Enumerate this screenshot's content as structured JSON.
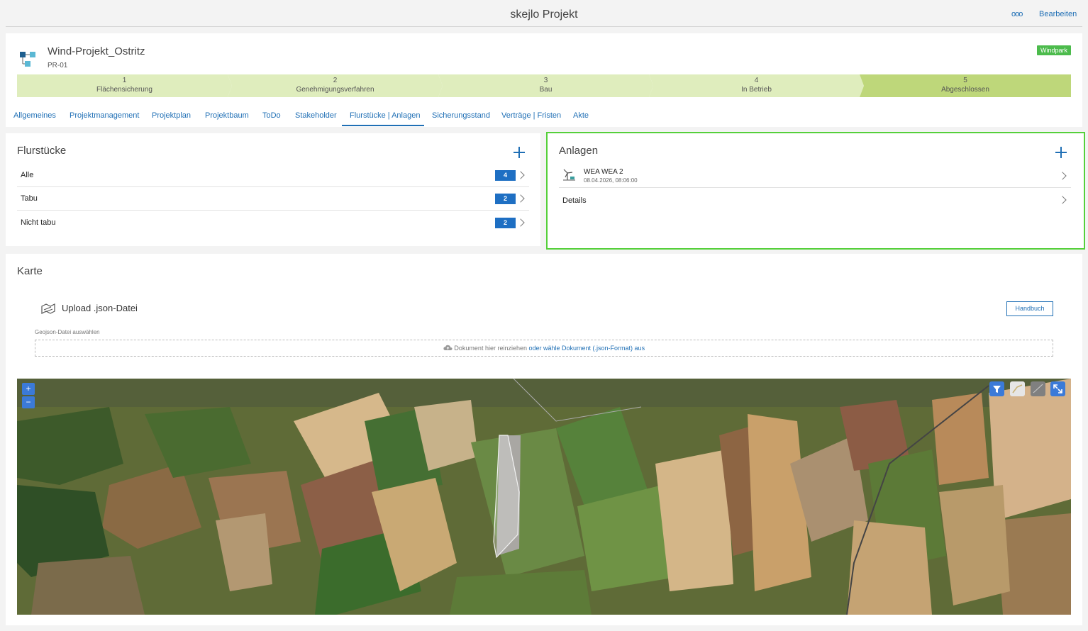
{
  "header": {
    "title": "skejlo Projekt",
    "more_label": "ooo",
    "edit_label": "Bearbeiten"
  },
  "project": {
    "name": "Wind-Projekt_Ostritz",
    "code": "PR-01",
    "type_badge": "Windpark",
    "icon": "project-tree-icon"
  },
  "phases": [
    {
      "num": "1",
      "label": "Flächensicherung"
    },
    {
      "num": "2",
      "label": "Genehmigungsverfahren"
    },
    {
      "num": "3",
      "label": "Bau"
    },
    {
      "num": "4",
      "label": "In Betrieb"
    },
    {
      "num": "5",
      "label": "Abgeschlossen"
    }
  ],
  "tabs": [
    "Allgemeines",
    "Projektmanagement",
    "Projektplan",
    "Projektbaum",
    "ToDo",
    "Stakeholder",
    "Flurstücke | Anlagen",
    "Sicherungsstand",
    "Verträge | Fristen",
    "Akte"
  ],
  "active_tab": "Flurstücke | Anlagen",
  "flurstuecke": {
    "title": "Flurstücke",
    "rows": [
      {
        "label": "Alle",
        "count": "4"
      },
      {
        "label": "Tabu",
        "count": "2"
      },
      {
        "label": "Nicht tabu",
        "count": "2"
      }
    ]
  },
  "anlagen": {
    "title": "Anlagen",
    "item": {
      "name": "WEA WEA 2",
      "timestamp": "08.04.2026, 08:06:00",
      "icon": "wind-turbine-icon"
    },
    "details_label": "Details"
  },
  "karte": {
    "title": "Karte",
    "upload_title": "Upload .json-Datei",
    "upload_icon": "map-upload-icon",
    "handbuch_label": "Handbuch",
    "drop_label": "Geojson-Datei auswählen",
    "drop_text": "Dokument hier reinziehen",
    "drop_link": "oder wähle Dokument (.json-Format) aus",
    "zoom_in": "+",
    "zoom_out": "−"
  },
  "colors": {
    "accent": "#1f6fb5",
    "phase_open": "#dfedbd",
    "phase_done": "#bed77a",
    "badge": "#4cbb4c",
    "highlight": "#55d03a"
  }
}
